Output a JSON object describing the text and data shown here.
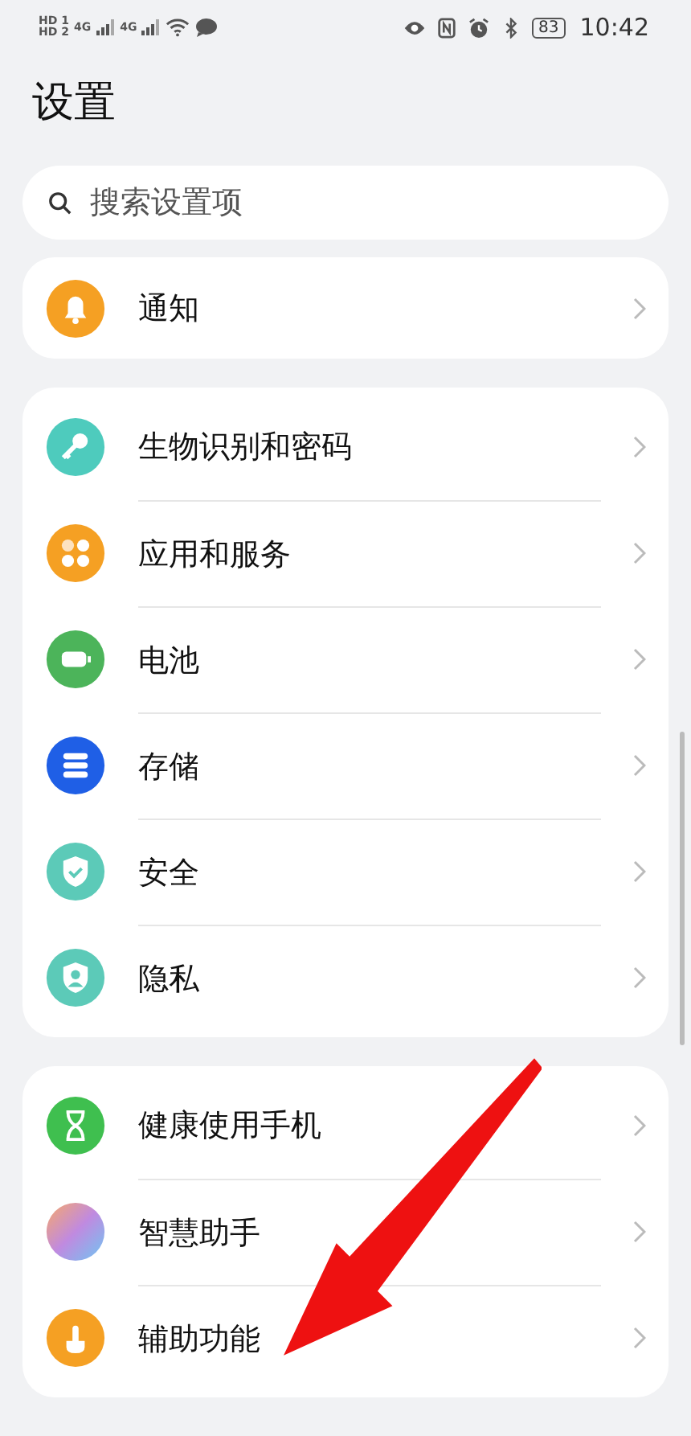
{
  "status_bar": {
    "sims": [
      "HD 1",
      "HD 2"
    ],
    "networks": [
      "4G",
      "4G"
    ],
    "battery": "83",
    "time": "10:42"
  },
  "title": "设置",
  "search": {
    "placeholder": "搜索设置项"
  },
  "groups": [
    {
      "items": [
        {
          "label": "通知",
          "kind": "bell",
          "color": "#f5a023"
        }
      ]
    },
    {
      "items": [
        {
          "label": "生物识别和密码",
          "kind": "key",
          "color": "#4ecbbd"
        },
        {
          "label": "应用和服务",
          "kind": "apps",
          "color": "#f5a023"
        },
        {
          "label": "电池",
          "kind": "battery",
          "color": "#4cb45a"
        },
        {
          "label": "存储",
          "kind": "storage",
          "color": "#1f5fe6"
        },
        {
          "label": "安全",
          "kind": "shield",
          "color": "#5ccab8"
        },
        {
          "label": "隐私",
          "kind": "privacy",
          "color": "#5ccab8"
        }
      ]
    },
    {
      "items": [
        {
          "label": "健康使用手机",
          "kind": "hourglass",
          "color": "#3fbf4f"
        },
        {
          "label": "智慧助手",
          "kind": "assistant",
          "color": "#c08ae0"
        },
        {
          "label": "辅助功能",
          "kind": "hand",
          "color": "#f5a023"
        }
      ]
    }
  ]
}
